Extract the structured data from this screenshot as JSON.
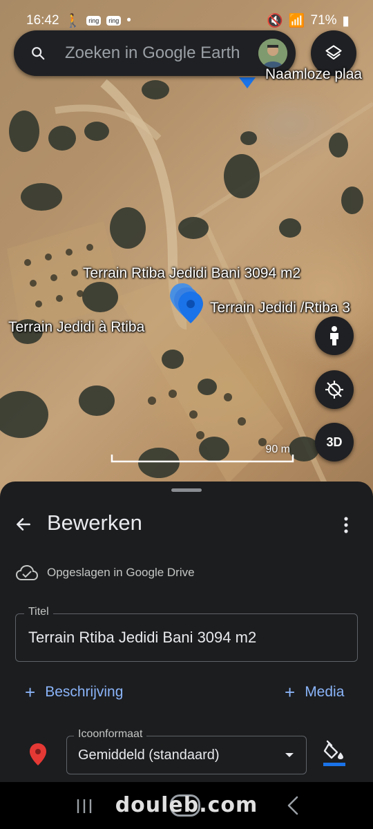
{
  "status_bar": {
    "time": "16:42",
    "ring_badges": [
      "ring",
      "ring"
    ],
    "battery": "71%"
  },
  "search": {
    "placeholder": "Zoeken in Google Earth"
  },
  "map": {
    "labels": {
      "top_place": "Naamloze plaa",
      "terrain_main": "Terrain Rtiba Jedidi  Bani 3094 m2",
      "terrain_right": "Terrain Jedidi /Rtiba 3",
      "terrain_left": "Terrain Jedidi à Rtiba"
    },
    "scale": "90 m",
    "btn_3d": "3D"
  },
  "sheet": {
    "title": "Bewerken",
    "drive_status": "Opgeslagen in Google Drive",
    "title_field": {
      "label": "Titel",
      "value": "Terrain Rtiba Jedidi  Bani 3094 m2"
    },
    "add_description": "Beschrijving",
    "add_media": "Media",
    "icon_format": {
      "label": "Icoonformaat",
      "value": "Gemiddeld (standaard)"
    }
  },
  "watermark": "douleb.com",
  "colors": {
    "accent": "#8ab4f8",
    "sheet_bg": "#1c1d1f",
    "pin_blue": "#1a73e8",
    "pin_red": "#e53935"
  }
}
